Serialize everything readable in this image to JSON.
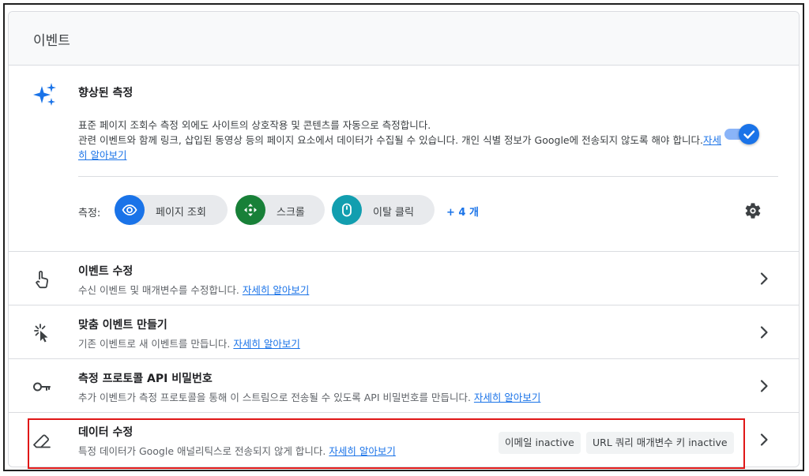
{
  "header": {
    "title": "이벤트"
  },
  "enhanced": {
    "title": "향상된 측정",
    "desc_line1": "표준 페이지 조회수 측정 외에도 사이트의 상호작용 및 콘텐츠를 자동으로 측정합니다.",
    "desc_line2": "관련 이벤트와 함께 링크, 삽입된 동영상 등의 페이지 요소에서 데이터가 수집될 수 있습니다. 개인 식별 정보가 Google에 전송되지 않도록 해야 합니다.",
    "learn_more": "자세히 알아보기",
    "toggle_on": true,
    "measurement_label": "측정:",
    "chips": [
      {
        "label": "페이지 조회",
        "icon": "eye-icon",
        "color": "#1a73e8"
      },
      {
        "label": "스크롤",
        "icon": "scroll-arrows-icon",
        "color": "#188038"
      },
      {
        "label": "이탈 클릭",
        "icon": "mouse-icon",
        "color": "#129eaf"
      }
    ],
    "more": "+ 4 개"
  },
  "rows": [
    {
      "title": "이벤트 수정",
      "desc": "수신 이벤트 및 매개변수를 수정합니다. ",
      "link": "자세히 알아보기",
      "icon": "touch-hand-icon"
    },
    {
      "title": "맞춤 이벤트 만들기",
      "desc": "기존 이벤트로 새 이벤트를 만듭니다. ",
      "link": "자세히 알아보기",
      "icon": "cursor-click-icon"
    },
    {
      "title": "측정 프로토콜 API 비밀번호",
      "desc": "추가 이벤트가 측정 프로토콜을 통해 이 스트림으로 전송될 수 있도록 API 비밀번호를 만듭니다. ",
      "link": "자세히 알아보기",
      "icon": "key-icon"
    },
    {
      "title": "데이터 수정",
      "desc": "특정 데이터가 Google 애널리틱스로 전송되지 않게 합니다. ",
      "link": "자세히 알아보기",
      "icon": "eraser-icon",
      "badges": [
        "이메일 inactive",
        "URL 쿼리 매개변수 키 inactive"
      ]
    }
  ],
  "colors": {
    "accent": "#1a73e8",
    "highlight": "#e01717"
  }
}
